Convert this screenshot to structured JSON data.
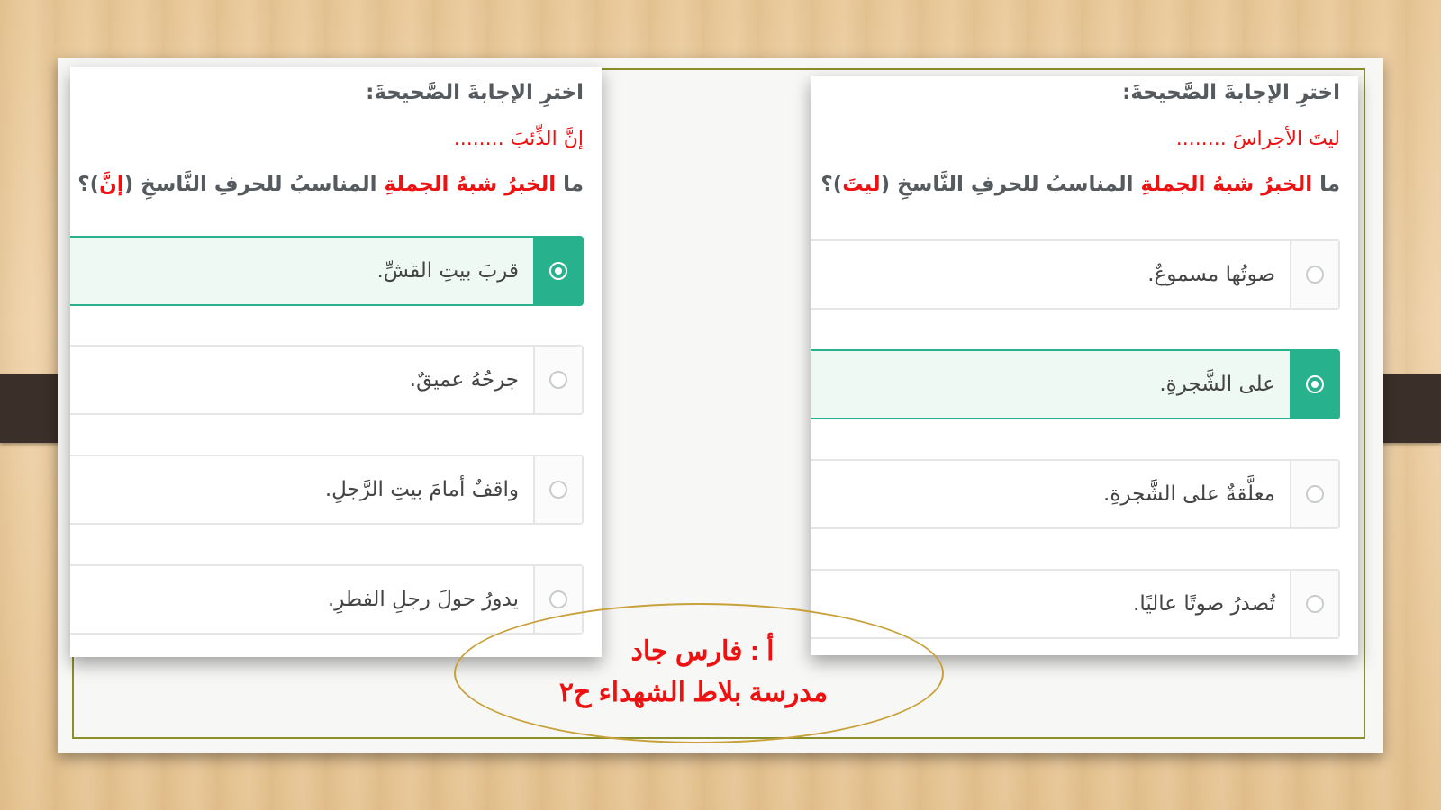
{
  "left_question": {
    "instruction": "اخترِ الإجابةَ الصَّحيحةَ:",
    "sentence": "إنَّ الذِّئبَ ........",
    "question_prefix": "ما ",
    "question_red": "الخبرُ شبهُ الجملةِ",
    "question_mid": " المناسبُ للحرفِ النَّاسخِ (",
    "question_particle": "إنَّ",
    "question_suffix": ")؟",
    "options": [
      {
        "text": "قربَ بيتِ القشِّ.",
        "selected": true
      },
      {
        "text": "جرحُهُ عميقٌ.",
        "selected": false
      },
      {
        "text": "واقفٌ أمامَ بيتِ الرَّجلِ.",
        "selected": false
      },
      {
        "text": "يدورُ حولَ رجلِ الفطرِ.",
        "selected": false
      }
    ]
  },
  "right_question": {
    "instruction": "اخترِ الإجابةَ الصَّحيحةَ:",
    "sentence": "ليتَ الأجراسَ ........",
    "question_prefix": "ما ",
    "question_red": "الخبرُ شبهُ الجملةِ",
    "question_mid": " المناسبُ للحرفِ النَّاسخِ (",
    "question_particle": "ليتَ",
    "question_suffix": ")؟",
    "options": [
      {
        "text": "صوتُها مسموعٌ.",
        "selected": false
      },
      {
        "text": "على الشَّجرةِ.",
        "selected": true
      },
      {
        "text": "معلَّقةٌ على الشَّجرةِ.",
        "selected": false
      },
      {
        "text": "تُصدرُ صوتًا عاليًا.",
        "selected": false
      }
    ]
  },
  "credit": {
    "line1": "أ : فارس جاد",
    "line2": "مدرسة بلاط الشهداء ح٢"
  },
  "colors": {
    "accent_green": "#27b28d",
    "question_red": "#ee1111",
    "frame_olive": "#8a8f2a",
    "oval_gold": "#c8a13a"
  }
}
